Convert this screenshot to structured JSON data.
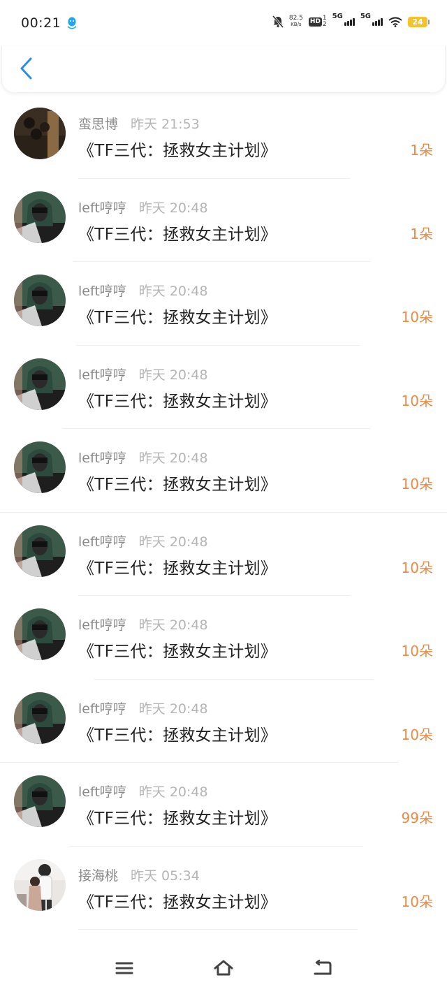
{
  "status_bar": {
    "time": "00:21",
    "net_speed_value": "82.5",
    "net_speed_unit": "KB/s",
    "hd_label": "HD",
    "hd_top": "1",
    "hd_bottom": "2",
    "sig1_label": "5G",
    "sig2_label": "5G",
    "battery": "24",
    "battery_color": "#f2c230"
  },
  "header": {
    "back_icon": "chevron-left-icon",
    "accent": "#2a8ee6"
  },
  "list": {
    "items": [
      {
        "name": "蛮思博",
        "time": "昨天 21:53",
        "title": "《TF三代：拯救女主计划》",
        "count": "1朵",
        "avatar": "avatar-1"
      },
      {
        "name": "left哼哼",
        "time": "昨天 20:48",
        "title": "《TF三代：拯救女主计划》",
        "count": "1朵",
        "avatar": "avatar-2"
      },
      {
        "name": "left哼哼",
        "time": "昨天 20:48",
        "title": "《TF三代：拯救女主计划》",
        "count": "10朵",
        "avatar": "avatar-2"
      },
      {
        "name": "left哼哼",
        "time": "昨天 20:48",
        "title": "《TF三代：拯救女主计划》",
        "count": "10朵",
        "avatar": "avatar-2"
      },
      {
        "name": "left哼哼",
        "time": "昨天 20:48",
        "title": "《TF三代：拯救女主计划》",
        "count": "10朵",
        "avatar": "avatar-2"
      },
      {
        "name": "left哼哼",
        "time": "昨天 20:48",
        "title": "《TF三代：拯救女主计划》",
        "count": "10朵",
        "avatar": "avatar-2"
      },
      {
        "name": "left哼哼",
        "time": "昨天 20:48",
        "title": "《TF三代：拯救女主计划》",
        "count": "10朵",
        "avatar": "avatar-2"
      },
      {
        "name": "left哼哼",
        "time": "昨天 20:48",
        "title": "《TF三代：拯救女主计划》",
        "count": "10朵",
        "avatar": "avatar-2"
      },
      {
        "name": "left哼哼",
        "time": "昨天 20:48",
        "title": "《TF三代：拯救女主计划》",
        "count": "99朵",
        "avatar": "avatar-2"
      },
      {
        "name": "接海桃",
        "time": "昨天 05:34",
        "title": "《TF三代：拯救女主计划》",
        "count": "10朵",
        "avatar": "avatar-3"
      }
    ],
    "count_color": "#ee8a44"
  },
  "bottom_nav": {
    "menu_icon": "menu-icon",
    "home_icon": "home-icon",
    "back_icon": "back-icon"
  }
}
